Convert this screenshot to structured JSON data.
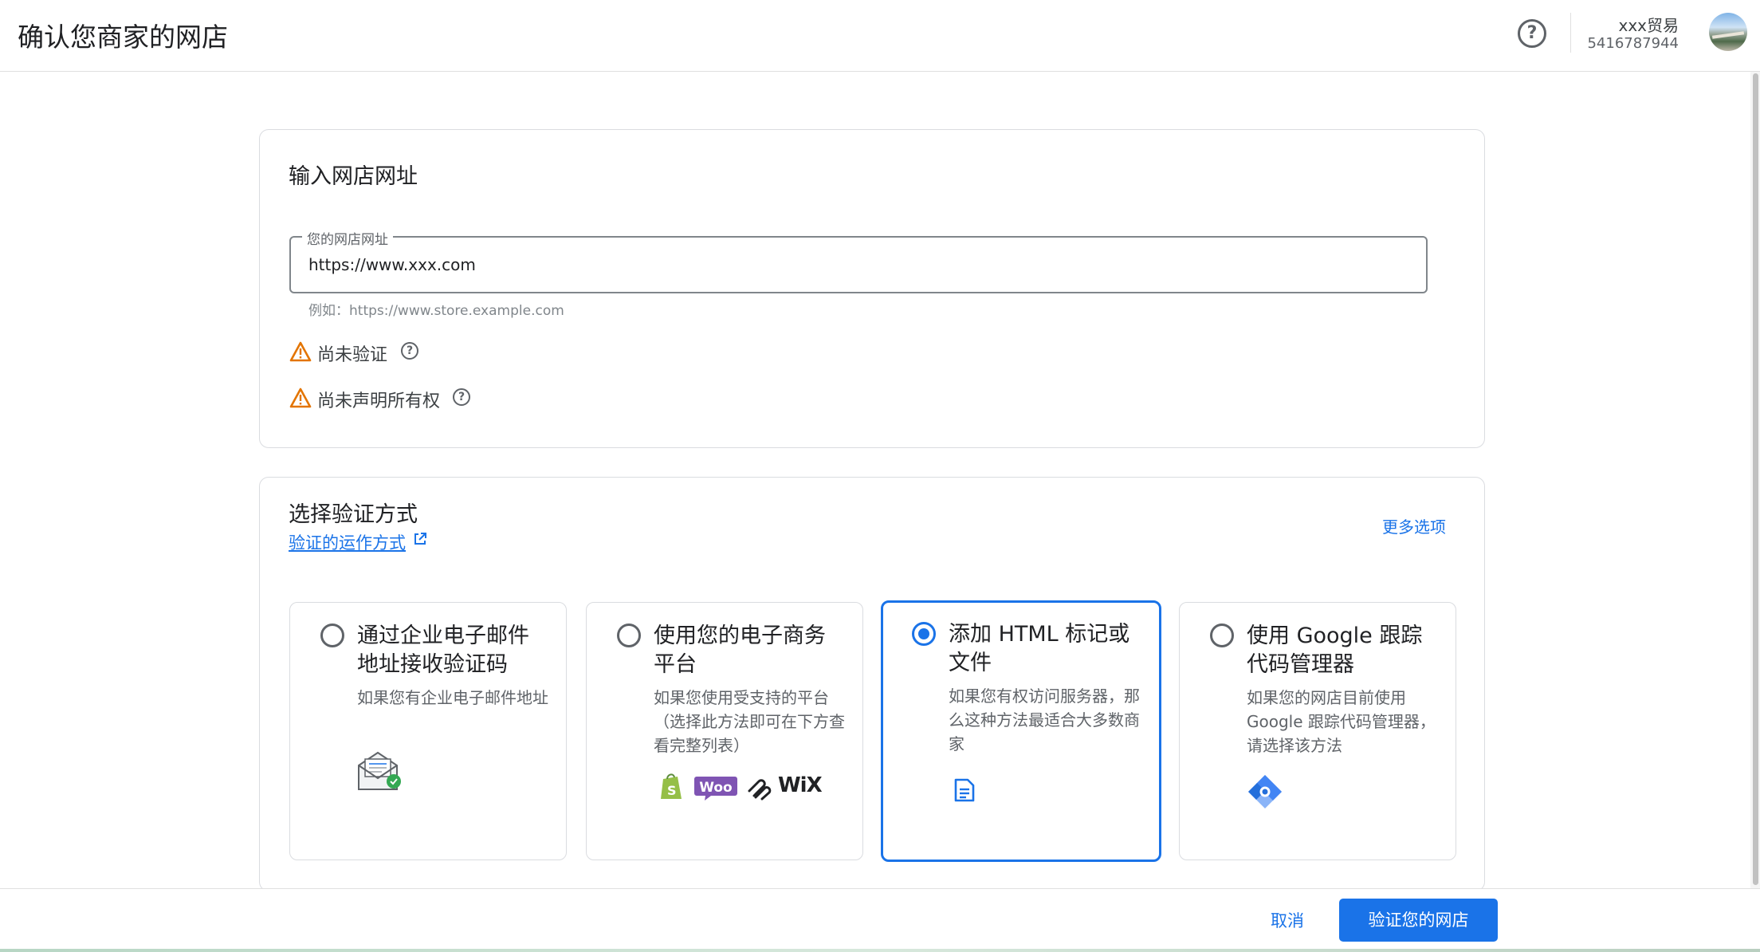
{
  "header": {
    "title": "确认您商家的网店",
    "help_glyph": "?",
    "account_name": "xxx贸易",
    "account_id": "5416787944"
  },
  "url_card": {
    "title": "输入网店网址",
    "field_label": "您的网店网址",
    "field_value": "https://www.xxx.com",
    "hint": "例如：https://www.store.example.com",
    "status_unverified": "尚未验证",
    "status_unclaimed": "尚未声明所有权",
    "info_glyph": "?"
  },
  "method_card": {
    "title": "选择验证方式",
    "learn_link": "验证的运作方式",
    "more_options": "更多选项",
    "options": [
      {
        "title": "通过企业电子邮件地址接收验证码",
        "desc": "如果您有企业电子邮件地址",
        "selected": false
      },
      {
        "title": "使用您的电子商务平台",
        "desc": "如果您使用受支持的平台（选择此方法即可在下方查看完整列表）",
        "selected": false
      },
      {
        "title": "添加 HTML 标记或文件",
        "desc": "如果您有权访问服务器，那么这种方法最适合大多数商家",
        "selected": true
      },
      {
        "title": "使用 Google 跟踪代码管理器",
        "desc": "如果您的网店目前使用 Google 跟踪代码管理器，请选择该方法",
        "selected": false
      }
    ],
    "platform_logos": {
      "woo": "Woo",
      "wix": "WiX"
    }
  },
  "footer": {
    "cancel": "取消",
    "verify": "验证您的网店"
  },
  "colors": {
    "accent": "#1a73e8",
    "warning": "#e37400",
    "text_primary": "#202124",
    "text_secondary": "#5f6368"
  },
  "icons": [
    "help-icon",
    "avatar",
    "warning-icon",
    "info-icon",
    "external-link-icon",
    "envelope-check-icon",
    "shopify-icon",
    "woocommerce-logo",
    "squarespace-icon",
    "wix-logo",
    "document-icon",
    "tag-manager-icon"
  ]
}
